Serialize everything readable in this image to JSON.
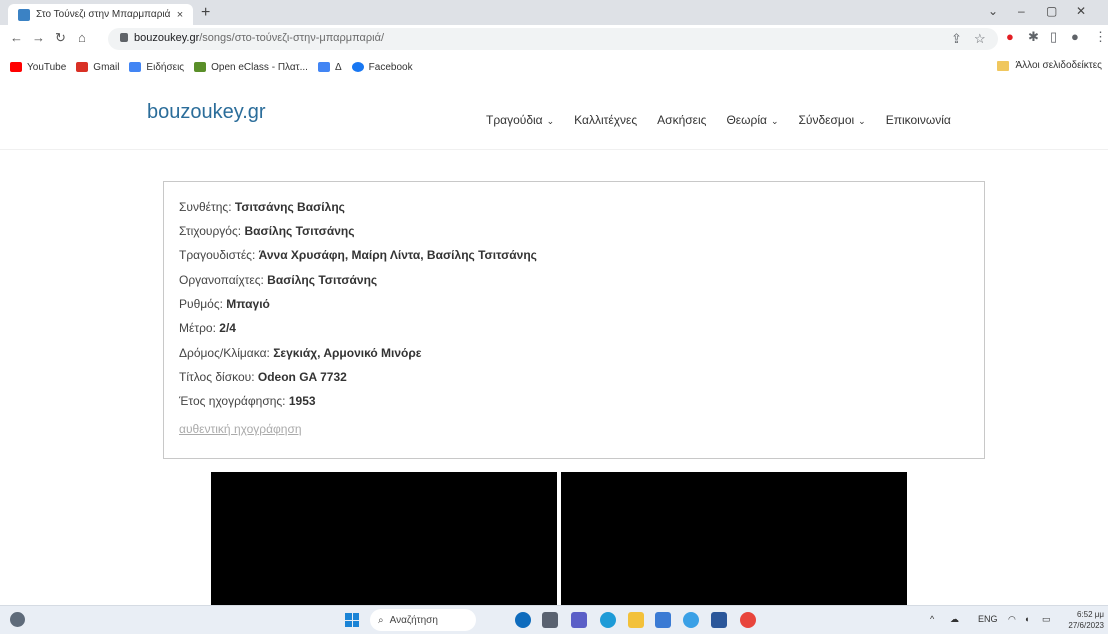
{
  "browser": {
    "tab_title": "Στο Τούνεζι στην Μπαρμπαριά",
    "tab_close": "×",
    "new_tab": "+",
    "window_controls": [
      "⌄",
      "–",
      "▢",
      "✕"
    ],
    "url_host": "bouzoukey.gr",
    "url_path": "/songs/στο-τούνεζι-στην-μπαρμπαριά/",
    "bookmarks": [
      {
        "label": "YouTube",
        "color": "#ff0000"
      },
      {
        "label": "Gmail",
        "color": "#d93025"
      },
      {
        "label": "Ειδήσεις",
        "color": "#4285f4"
      },
      {
        "label": "Open eClass - Πλατ...",
        "color": "#5a8f29"
      },
      {
        "label": "Δ",
        "color": "#4285f4"
      },
      {
        "label": "Facebook",
        "color": "#1877f2"
      }
    ],
    "other_bookmarks": "Άλλοι σελιδοδείκτες"
  },
  "site": {
    "logo": "bouzoukey.gr",
    "nav": [
      {
        "label": "Τραγούδια",
        "dropdown": true
      },
      {
        "label": "Καλλιτέχνες",
        "dropdown": false
      },
      {
        "label": "Ασκήσεις",
        "dropdown": false
      },
      {
        "label": "Θεωρία",
        "dropdown": true
      },
      {
        "label": "Σύνδεσμοι",
        "dropdown": true
      },
      {
        "label": "Επικοινωνία",
        "dropdown": false
      }
    ]
  },
  "song": {
    "composer_label": "Συνθέτης:",
    "composer": "Τσιτσάνης Βασίλης",
    "lyricist_label": "Στιχουργός:",
    "lyricist": "Βασίλης Τσιτσάνης",
    "singers_label": "Τραγουδιστές:",
    "singers": "Άννα Χρυσάφη, Μαίρη Λίντα, Βασίλης Τσιτσάνης",
    "musicians_label": "Οργανοπαίχτες:",
    "musicians": "Βασίλης Τσιτσάνης",
    "rhythm_label": "Ρυθμός:",
    "rhythm": "Μπαγιό",
    "meter_label": "Μέτρο:",
    "meter": "2/4",
    "scale_label": "Δρόμος/Κλίμακα:",
    "scale": "Σεγκιάχ, Αρμονικό Μινόρε",
    "record_label": "Τίτλος δίσκου:",
    "record": "Odeon GA 7732",
    "year_label": "Έτος ηχογράφησης:",
    "year": "1953",
    "original_recording": "αυθεντική ηχογράφηση"
  },
  "taskbar": {
    "search": "Αναζήτηση",
    "lang": "ENG",
    "time": "6:52 μμ",
    "date": "27/6/2023"
  }
}
